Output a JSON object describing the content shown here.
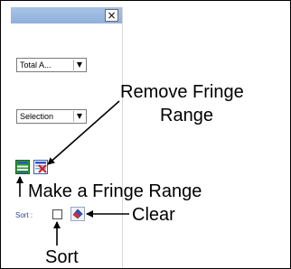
{
  "panel": {
    "close_glyph": "×",
    "combo_total": {
      "value": "Total A...",
      "arrow": "▼"
    },
    "combo_selection": {
      "value": "Selection",
      "arrow": "▼"
    },
    "sort_label": "Sort :"
  },
  "icons": {
    "make_fringe_range": "fringe-range-icon",
    "remove_fringe_range": "remove-fringe-range-icon",
    "clear": "clear-eraser-icon"
  },
  "annotations": {
    "remove_fringe_range": [
      "Remove Fringe",
      "Range"
    ],
    "make_fringe_range": "Make a Fringe Range",
    "clear": "Clear",
    "sort": "Sort"
  }
}
